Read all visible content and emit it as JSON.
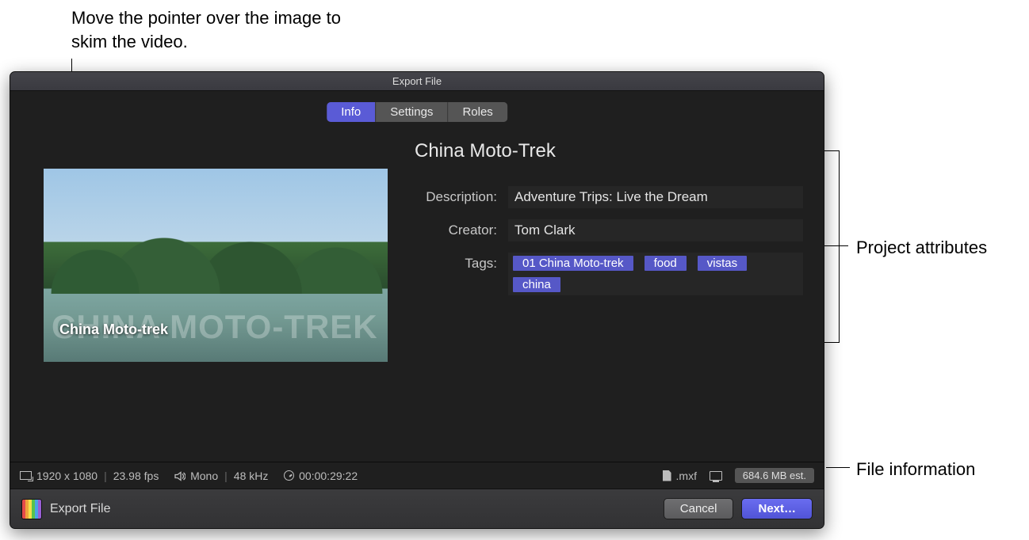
{
  "callouts": {
    "skim": "Move the pointer over the image to skim the video.",
    "project_attributes": "Project attributes",
    "file_information": "File information"
  },
  "window": {
    "title": "Export File"
  },
  "tabs": {
    "info": "Info",
    "settings": "Settings",
    "roles": "Roles"
  },
  "project": {
    "title": "China Moto-Trek"
  },
  "preview": {
    "overlay_big": "CHINA MOTO-TREK",
    "overlay_small": "China Moto-trek"
  },
  "attributes": {
    "description_label": "Description:",
    "description_value": "Adventure Trips: Live the Dream",
    "creator_label": "Creator:",
    "creator_value": "Tom Clark",
    "tags_label": "Tags:",
    "tags": [
      "01 China Moto-trek",
      "food",
      "vistas",
      "china"
    ]
  },
  "status": {
    "resolution": "1920 x 1080",
    "fps": "23.98 fps",
    "audio": "Mono",
    "sample_rate": "48 kHz",
    "duration": "00:00:29:22",
    "container": ".mxf",
    "size_estimate": "684.6 MB est."
  },
  "footer": {
    "title": "Export File",
    "cancel": "Cancel",
    "next": "Next…"
  }
}
